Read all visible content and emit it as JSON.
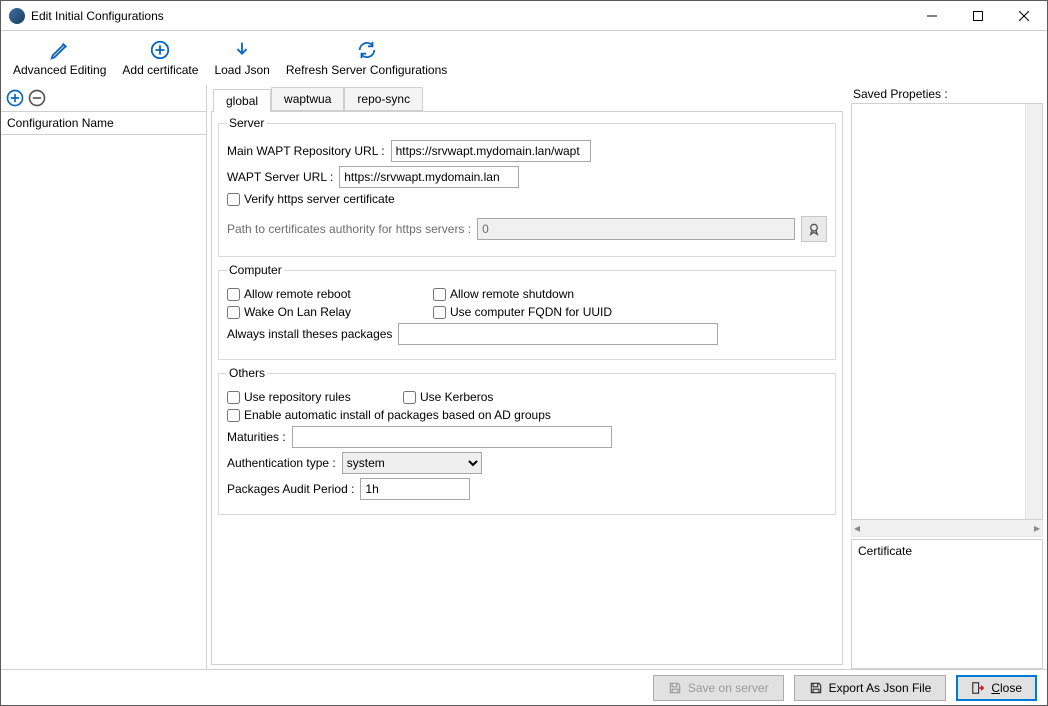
{
  "window": {
    "title": "Edit Initial Configurations"
  },
  "toolbar": {
    "advanced": "Advanced Editing",
    "addcert": "Add certificate",
    "loadjson": "Load Json",
    "refresh": "Refresh Server Configurations"
  },
  "left": {
    "header": "Configuration Name"
  },
  "tabs": {
    "global": "global",
    "waptwua": "waptwua",
    "reposync": "repo-sync"
  },
  "server": {
    "legend": "Server",
    "repo_label": "Main WAPT Repository URL :",
    "repo_value": "https://srvwapt.mydomain.lan/wapt",
    "server_label": "WAPT Server URL :",
    "server_value": "https://srvwapt.mydomain.lan",
    "verify_label": "Verify https server certificate",
    "capath_label": "Path to certificates authority for https servers :",
    "capath_value": "0"
  },
  "computer": {
    "legend": "Computer",
    "allow_reboot": "Allow remote reboot",
    "allow_shutdown": "Allow remote shutdown",
    "wol": "Wake On Lan Relay",
    "fqdn": "Use computer FQDN for UUID",
    "always_label": "Always install theses packages"
  },
  "others": {
    "legend": "Others",
    "repo_rules": "Use repository rules",
    "kerberos": "Use Kerberos",
    "ad_groups": "Enable automatic install of packages based on AD groups",
    "maturities_label": "Maturities :",
    "auth_label": "Authentication type :",
    "auth_value": "system",
    "audit_label": "Packages Audit Period :",
    "audit_value": "1h"
  },
  "right": {
    "saved": "Saved Propeties :",
    "cert": "Certificate"
  },
  "footer": {
    "save": "Save on server",
    "export": "Export As Json File",
    "close": "Close"
  }
}
